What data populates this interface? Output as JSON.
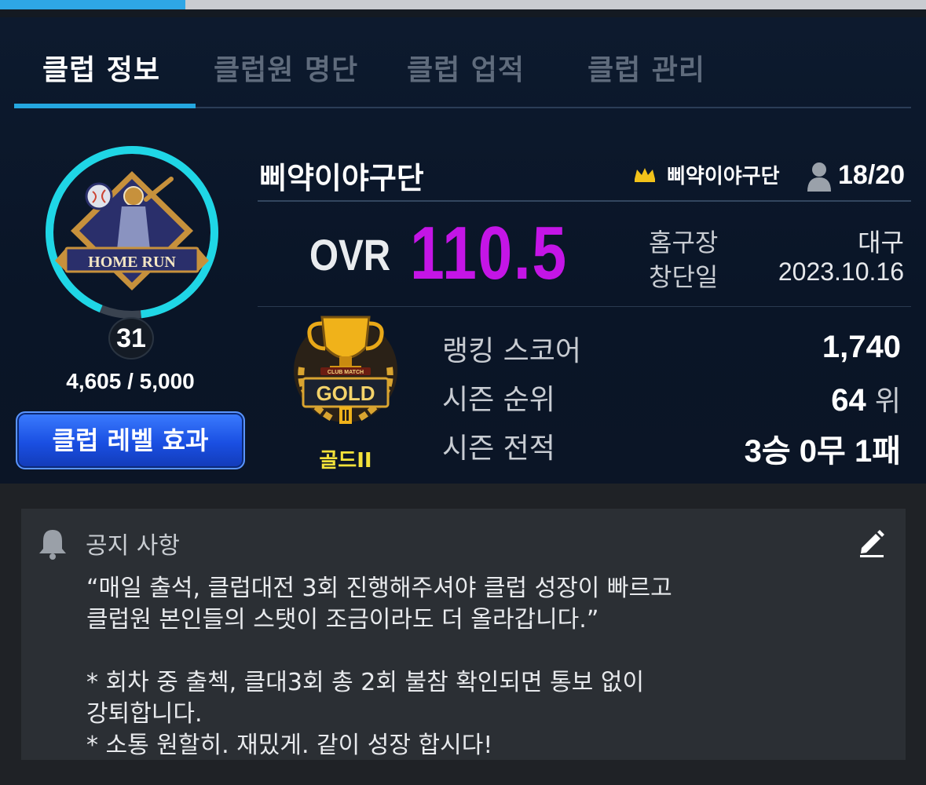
{
  "tabs": [
    {
      "label": "클럽 정보",
      "active": true
    },
    {
      "label": "클럽원 명단",
      "active": false
    },
    {
      "label": "클럽 업적",
      "active": false
    },
    {
      "label": "클럽 관리",
      "active": false
    }
  ],
  "club": {
    "name": "삐약이야구단",
    "leader": "삐약이야구단",
    "members": "18/20",
    "emblem_text": "HOME RUN",
    "level": "31",
    "exp": "4,605 / 5,000",
    "exp_progress": 0.921,
    "level_button": "클럽 레벨 효과"
  },
  "ovr": {
    "label": "OVR",
    "value": "110.5"
  },
  "info": {
    "home_label": "홈구장",
    "home_value": "대구",
    "founded_label": "창단일",
    "founded_value": "2023.10.16"
  },
  "tier": {
    "name": "골드II",
    "badge_text": "GOLD",
    "badge_subtext": "CLUB MATCH"
  },
  "stats": {
    "ranking_label": "랭킹 스코어",
    "ranking_value": "1,740",
    "season_rank_label": "시즌 순위",
    "season_rank_value": "64",
    "season_rank_unit": "위",
    "record_label": "시즌 전적",
    "record_value": "3승 0무 1패"
  },
  "notice": {
    "title": "공지 사항",
    "body": "“매일 출석, 클럽대전 3회 진행해주셔야 클럽 성장이 빠르고\n클럽원 본인들의 스탯이 조금이라도 더 올라갑니다.”\n\n* 회차 중 출첵, 클대3회 총 2회 불참 확인되면 통보 없이\n강퇴합니다.\n* 소통 원할히. 재밌게. 같이 성장 합시다!"
  },
  "colors": {
    "accent": "#25a7e0",
    "ovr": "#c415e6",
    "tier": "#f4e23a",
    "ring": "#1fd6e6",
    "button": "#1a4fe2"
  },
  "icons": [
    "crown-icon",
    "person-icon",
    "bell-icon",
    "pencil-icon"
  ]
}
